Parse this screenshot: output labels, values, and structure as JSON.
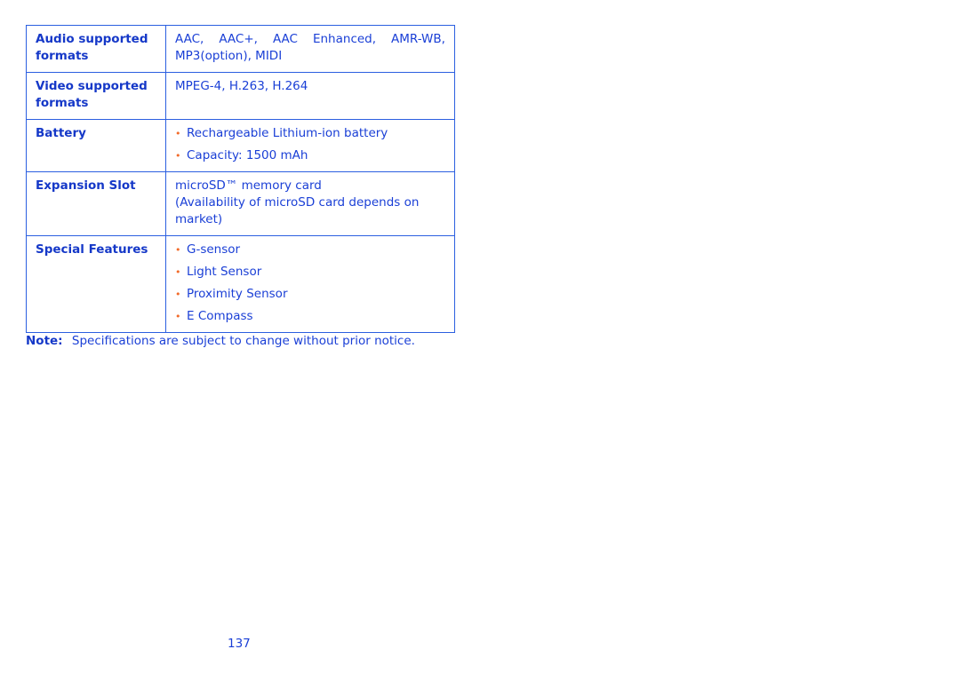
{
  "spec_table": {
    "rows": [
      {
        "label": "Audio supported formats",
        "value_line1_parts": [
          "AAC,",
          "AAC+,",
          "AAC",
          "Enhanced,",
          "AMR-WB,"
        ],
        "value_line2": "MP3(option), MIDI"
      },
      {
        "label": "Video supported formats",
        "value": "MPEG-4, H.263, H.264"
      },
      {
        "label": "Battery",
        "bullets": [
          "Rechargeable Lithium-ion battery",
          "Capacity: 1500 mAh"
        ]
      },
      {
        "label": "Expansion Slot",
        "value_lines": [
          "microSD™ memory card",
          "(Availability of microSD card depends on",
          "market)"
        ]
      },
      {
        "label": "Special Features",
        "bullets": [
          "G-sensor",
          "Light Sensor",
          "Proximity Sensor",
          "E Compass"
        ]
      }
    ]
  },
  "bullet_glyph": "•",
  "colors": {
    "text": "#1a3fd6",
    "label": "#1538c8",
    "border": "#2b5fe0",
    "bullet": "#f26b2a"
  },
  "note": {
    "label": "Note:",
    "text": "Specifications are subject to change without prior notice."
  },
  "page_number": "137"
}
